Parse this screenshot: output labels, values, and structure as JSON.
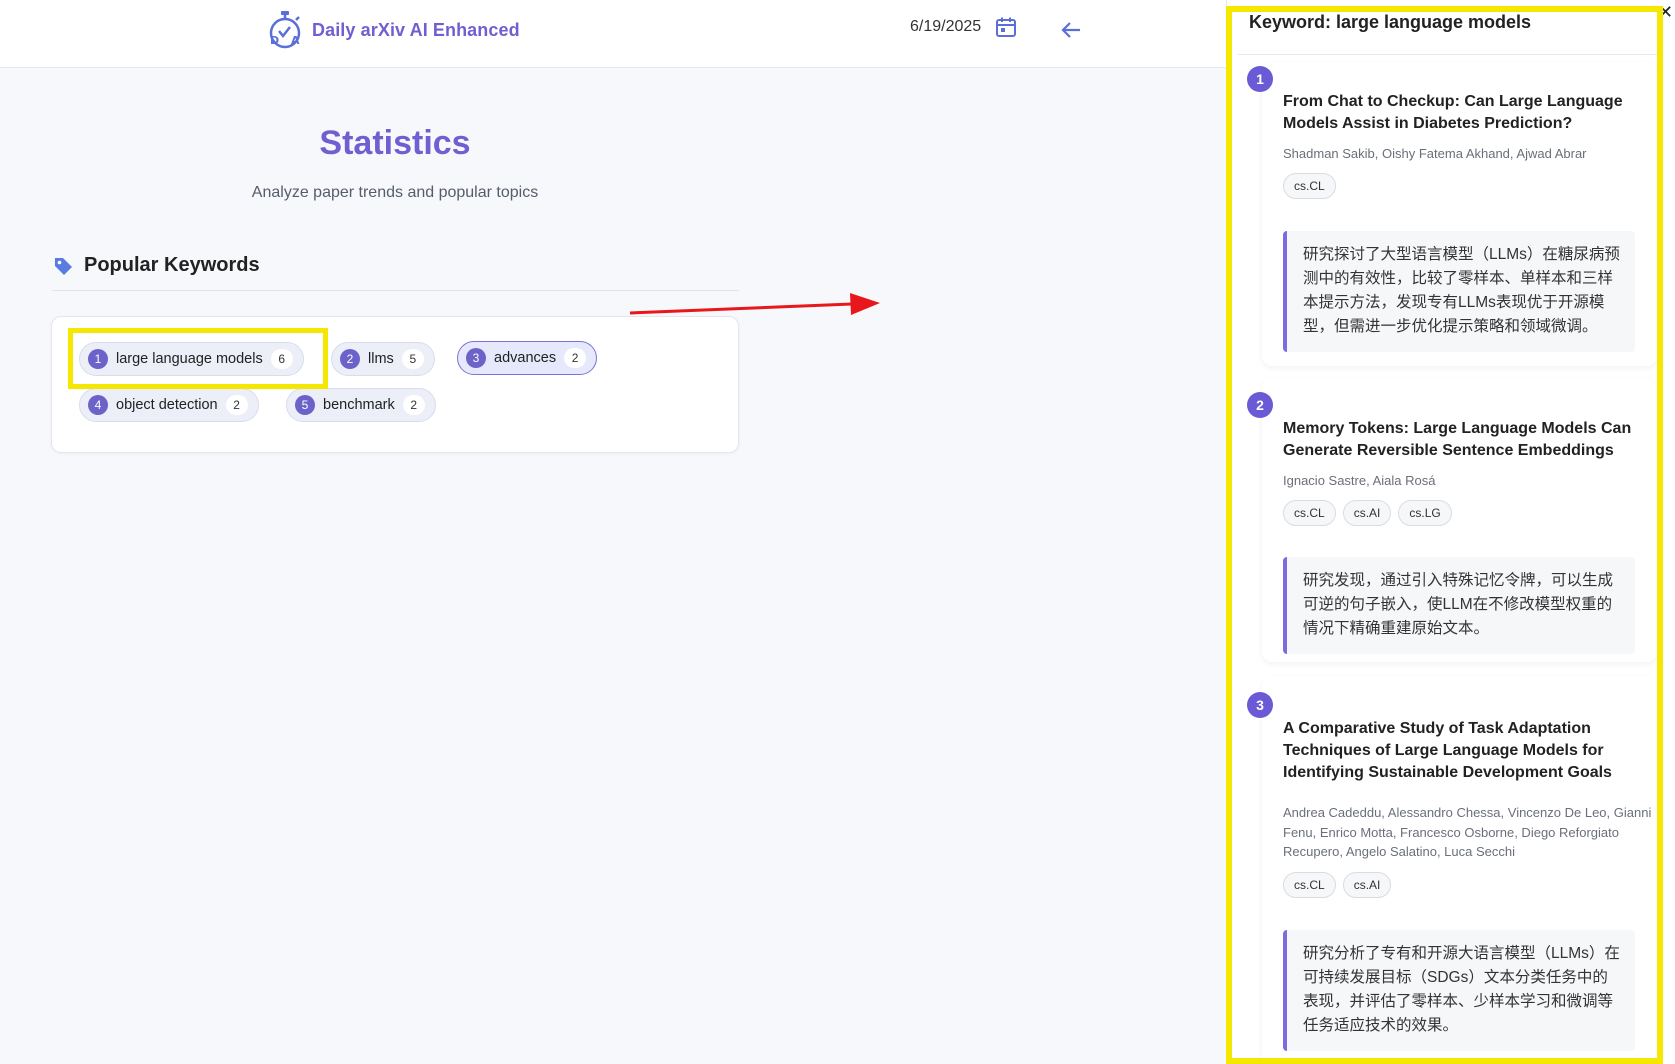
{
  "header": {
    "app_title": "Daily arXiv AI Enhanced",
    "logo_letters": "DVA",
    "date": "6/19/2025",
    "accent_color": "#6f5fd0"
  },
  "stats": {
    "title": "Statistics",
    "subtitle": "Analyze paper trends and popular topics",
    "section_title": "Popular Keywords",
    "keywords": [
      {
        "rank": "1",
        "label": "large language models",
        "count": "6"
      },
      {
        "rank": "2",
        "label": "llms",
        "count": "5"
      },
      {
        "rank": "3",
        "label": "advances",
        "count": "2"
      },
      {
        "rank": "4",
        "label": "object detection",
        "count": "2"
      },
      {
        "rank": "5",
        "label": "benchmark",
        "count": "2"
      }
    ]
  },
  "panel": {
    "title": "Keyword: large language models",
    "papers": [
      {
        "rank": "1",
        "title": "From Chat to Checkup: Can Large Language Models Assist in Diabetes Prediction?",
        "authors": "Shadman Sakib, Oishy Fatema Akhand, Ajwad Abrar",
        "categories": [
          "cs.CL"
        ],
        "summary": "研究探讨了大型语言模型（LLMs）在糖尿病预测中的有效性，比较了零样本、单样本和三样本提示方法，发现专有LLMs表现优于开源模型，但需进一步优化提示策略和领域微调。"
      },
      {
        "rank": "2",
        "title": "Memory Tokens: Large Language Models Can Generate Reversible Sentence Embeddings",
        "authors": "Ignacio Sastre, Aiala Rosá",
        "categories": [
          "cs.CL",
          "cs.AI",
          "cs.LG"
        ],
        "summary": "研究发现，通过引入特殊记忆令牌，可以生成可逆的句子嵌入，使LLM在不修改模型权重的情况下精确重建原始文本。"
      },
      {
        "rank": "3",
        "title": "A Comparative Study of Task Adaptation Techniques of Large Language Models for Identifying Sustainable Development Goals",
        "authors": "Andrea Cadeddu, Alessandro Chessa, Vincenzo De Leo, Gianni Fenu, Enrico Motta, Francesco Osborne, Diego Reforgiato Recupero, Angelo Salatino, Luca Secchi",
        "categories": [
          "cs.CL",
          "cs.AI"
        ],
        "summary": "研究分析了专有和开源大语言模型（LLMs）在可持续发展目标（SDGs）文本分类任务中的表现，并评估了零样本、少样本学习和微调等任务适应技术的效果。"
      }
    ]
  }
}
